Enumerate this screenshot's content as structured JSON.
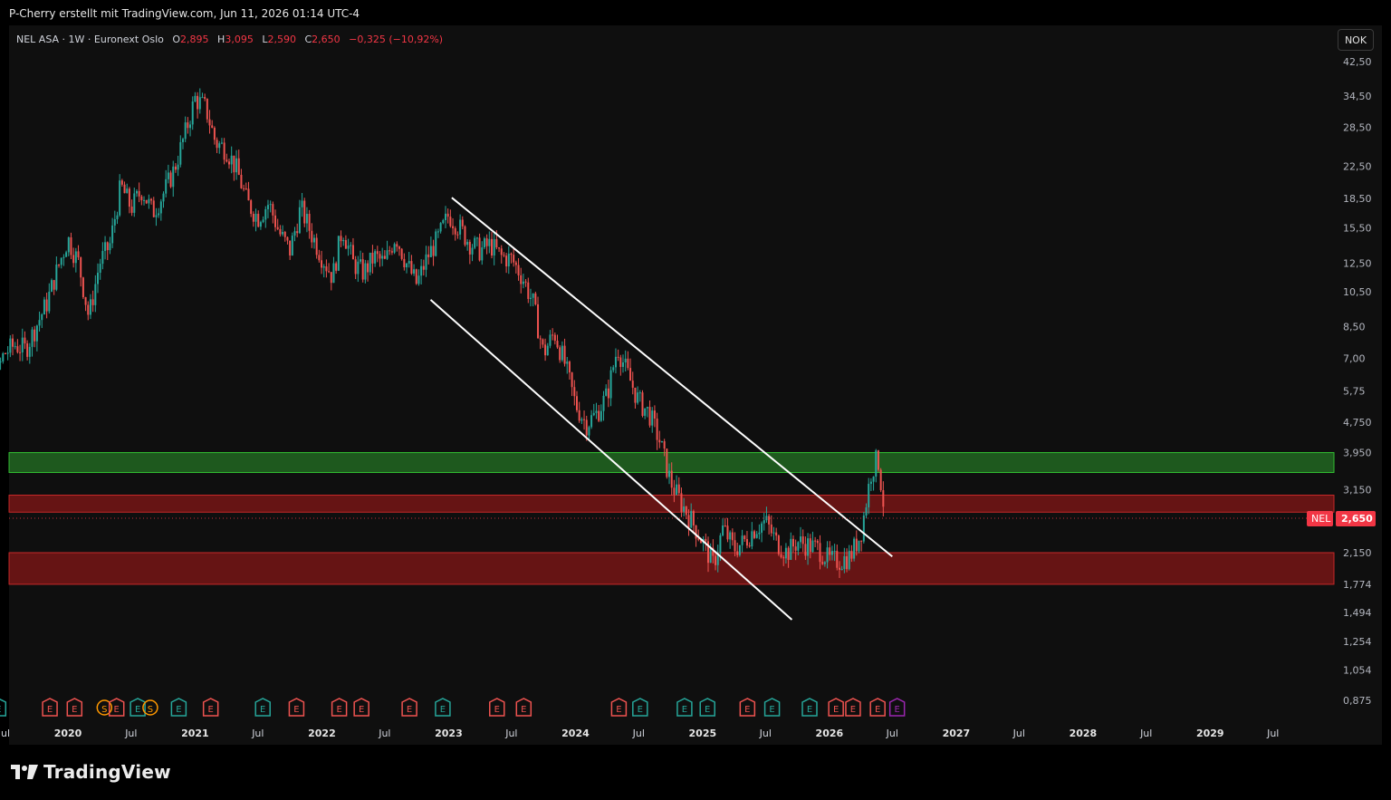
{
  "credit": "P-Cherry erstellt mit TradingView.com, Jun 11, 2026 01:14 UTC-4",
  "legend": {
    "symbol": "NEL ASA · 1W · Euronext Oslo",
    "o_label": "O",
    "o": "2,895",
    "h_label": "H",
    "h": "3,095",
    "l_label": "L",
    "l": "2,590",
    "c_label": "C",
    "c": "2,650",
    "change": "−0,325 (−10,92%)"
  },
  "currency": "NOK",
  "brand": "TradingView",
  "colors": {
    "up": "#26a69a",
    "down": "#ef5350",
    "support_zone": "#1f5d1f",
    "resistance_zone": "#6b1515",
    "channel": "#ffffff",
    "price_tag": "#f23645"
  },
  "chart_data": {
    "type": "candlestick",
    "symbol": "NEL",
    "timeframe": "1W",
    "y_scale": "log",
    "y_ticks": [
      "42,50",
      "34,50",
      "28,50",
      "22,50",
      "18,50",
      "15,50",
      "12,50",
      "10,50",
      "8,50",
      "7,00",
      "5,75",
      "4,750",
      "3,950",
      "3,150",
      "2,150",
      "1,774",
      "1,494",
      "1,254",
      "1,054",
      "0,875"
    ],
    "y_tick_values": [
      42.5,
      34.5,
      28.5,
      22.5,
      18.5,
      15.5,
      12.5,
      10.5,
      8.5,
      7.0,
      5.75,
      4.75,
      3.95,
      3.15,
      2.15,
      1.774,
      1.494,
      1.254,
      1.054,
      0.875
    ],
    "x_ticks": [
      {
        "label": "Jul",
        "date": "2019-07-01",
        "year": false
      },
      {
        "label": "2020",
        "date": "2020-01-01",
        "year": true
      },
      {
        "label": "Jul",
        "date": "2020-07-01",
        "year": false
      },
      {
        "label": "2021",
        "date": "2021-01-01",
        "year": true
      },
      {
        "label": "Jul",
        "date": "2021-07-01",
        "year": false
      },
      {
        "label": "2022",
        "date": "2022-01-01",
        "year": true
      },
      {
        "label": "Jul",
        "date": "2022-07-01",
        "year": false
      },
      {
        "label": "2023",
        "date": "2023-01-01",
        "year": true
      },
      {
        "label": "Jul",
        "date": "2023-07-01",
        "year": false
      },
      {
        "label": "2024",
        "date": "2024-01-01",
        "year": true
      },
      {
        "label": "Jul",
        "date": "2024-07-01",
        "year": false
      },
      {
        "label": "2025",
        "date": "2025-01-01",
        "year": true
      },
      {
        "label": "Jul",
        "date": "2025-07-01",
        "year": false
      },
      {
        "label": "2026",
        "date": "2026-01-01",
        "year": true
      },
      {
        "label": "Jul",
        "date": "2026-07-01",
        "year": false
      },
      {
        "label": "2027",
        "date": "2027-01-01",
        "year": true
      },
      {
        "label": "Jul",
        "date": "2027-07-01",
        "year": false
      },
      {
        "label": "2028",
        "date": "2028-01-01",
        "year": true
      },
      {
        "label": "Jul",
        "date": "2028-07-01",
        "year": false
      },
      {
        "label": "2029",
        "date": "2029-01-01",
        "year": true
      },
      {
        "label": "Jul",
        "date": "2029-07-01",
        "year": false
      }
    ],
    "price_path": [
      [
        "2019-03-01",
        5.8
      ],
      [
        "2019-04-01",
        8.0
      ],
      [
        "2019-05-01",
        6.8
      ],
      [
        "2019-06-01",
        6.0
      ],
      [
        "2019-07-01",
        7.2
      ],
      [
        "2019-08-01",
        7.6
      ],
      [
        "2019-09-01",
        7.4
      ],
      [
        "2019-10-01",
        8.5
      ],
      [
        "2019-11-01",
        9.8
      ],
      [
        "2019-12-01",
        12.0
      ],
      [
        "2020-01-01",
        14.5
      ],
      [
        "2020-02-01",
        12.5
      ],
      [
        "2020-03-01",
        9.0
      ],
      [
        "2020-04-01",
        12.5
      ],
      [
        "2020-05-01",
        14.0
      ],
      [
        "2020-06-01",
        20.0
      ],
      [
        "2020-07-01",
        17.5
      ],
      [
        "2020-08-01",
        19.5
      ],
      [
        "2020-09-01",
        17.0
      ],
      [
        "2020-10-01",
        19.0
      ],
      [
        "2020-11-01",
        22.0
      ],
      [
        "2020-12-01",
        27.0
      ],
      [
        "2021-01-01",
        34.0
      ],
      [
        "2021-02-01",
        32.0
      ],
      [
        "2021-03-01",
        26.0
      ],
      [
        "2021-04-01",
        25.0
      ],
      [
        "2021-05-01",
        22.0
      ],
      [
        "2021-06-01",
        18.0
      ],
      [
        "2021-07-01",
        16.5
      ],
      [
        "2021-08-01",
        18.0
      ],
      [
        "2021-09-01",
        15.0
      ],
      [
        "2021-10-01",
        13.5
      ],
      [
        "2021-11-01",
        17.5
      ],
      [
        "2021-12-01",
        15.0
      ],
      [
        "2022-01-01",
        13.0
      ],
      [
        "2022-02-01",
        11.5
      ],
      [
        "2022-03-01",
        15.5
      ],
      [
        "2022-04-01",
        12.5
      ],
      [
        "2022-05-01",
        11.8
      ],
      [
        "2022-06-01",
        13.0
      ],
      [
        "2022-07-01",
        12.5
      ],
      [
        "2022-08-01",
        14.8
      ],
      [
        "2022-09-01",
        12.5
      ],
      [
        "2022-10-01",
        11.0
      ],
      [
        "2022-11-01",
        13.0
      ],
      [
        "2022-12-01",
        14.5
      ],
      [
        "2023-01-01",
        16.8
      ],
      [
        "2023-02-01",
        15.5
      ],
      [
        "2023-03-01",
        14.2
      ],
      [
        "2023-04-01",
        13.5
      ],
      [
        "2023-05-01",
        14.0
      ],
      [
        "2023-06-01",
        13.0
      ],
      [
        "2023-07-01",
        12.8
      ],
      [
        "2023-08-01",
        11.5
      ],
      [
        "2023-09-01",
        9.8
      ],
      [
        "2023-10-01",
        7.2
      ],
      [
        "2023-11-01",
        8.2
      ],
      [
        "2023-12-01",
        6.8
      ],
      [
        "2024-01-01",
        5.3
      ],
      [
        "2024-02-01",
        4.7
      ],
      [
        "2024-03-01",
        5.0
      ],
      [
        "2024-04-01",
        5.6
      ],
      [
        "2024-05-01",
        7.5
      ],
      [
        "2024-06-01",
        6.3
      ],
      [
        "2024-07-01",
        5.4
      ],
      [
        "2024-08-01",
        5.0
      ],
      [
        "2024-09-01",
        4.2
      ],
      [
        "2024-10-01",
        3.3
      ],
      [
        "2024-11-01",
        2.9
      ],
      [
        "2024-12-01",
        2.6
      ],
      [
        "2025-01-01",
        2.3
      ],
      [
        "2025-02-01",
        2.0
      ],
      [
        "2025-03-01",
        2.5
      ],
      [
        "2025-04-01",
        2.2
      ],
      [
        "2025-05-01",
        2.3
      ],
      [
        "2025-06-01",
        2.5
      ],
      [
        "2025-07-01",
        2.6
      ],
      [
        "2025-08-01",
        2.3
      ],
      [
        "2025-09-01",
        2.15
      ],
      [
        "2025-10-01",
        2.3
      ],
      [
        "2025-11-01",
        2.25
      ],
      [
        "2025-12-01",
        2.2
      ],
      [
        "2026-01-01",
        2.05
      ],
      [
        "2026-02-01",
        2.05
      ],
      [
        "2026-03-01",
        2.1
      ],
      [
        "2026-04-01",
        2.4
      ],
      [
        "2026-05-01",
        3.5
      ],
      [
        "2026-05-20",
        3.85
      ],
      [
        "2026-06-11",
        2.65
      ]
    ],
    "last_price": "2,650",
    "last_price_label": "NEL",
    "zones": [
      {
        "kind": "support",
        "from": 3.95,
        "to": 3.5
      },
      {
        "kind": "resistance",
        "from": 3.05,
        "to": 2.75
      },
      {
        "kind": "resistance",
        "from": 2.15,
        "to": 1.774
      }
    ],
    "channel": [
      {
        "from": [
          "2023-01-10",
          18.6
        ],
        "to": [
          "2026-07-01",
          2.1
        ]
      },
      {
        "from": [
          "2022-11-10",
          10.0
        ],
        "to": [
          "2025-09-15",
          1.43
        ]
      }
    ],
    "event_markers": [
      {
        "date": "2019-06-15",
        "code": "E",
        "color": "#26a69a"
      },
      {
        "date": "2019-11-10",
        "code": "E",
        "color": "#ef5350"
      },
      {
        "date": "2020-01-20",
        "code": "E",
        "color": "#ef5350"
      },
      {
        "date": "2020-04-15",
        "code": "S",
        "color": "#ff9800"
      },
      {
        "date": "2020-05-20",
        "code": "E",
        "color": "#ef5350"
      },
      {
        "date": "2020-07-20",
        "code": "E",
        "color": "#26a69a"
      },
      {
        "date": "2020-08-25",
        "code": "S",
        "color": "#ff9800"
      },
      {
        "date": "2020-11-15",
        "code": "E",
        "color": "#26a69a"
      },
      {
        "date": "2021-02-15",
        "code": "E",
        "color": "#ef5350"
      },
      {
        "date": "2021-07-15",
        "code": "E",
        "color": "#26a69a"
      },
      {
        "date": "2021-10-20",
        "code": "E",
        "color": "#ef5350"
      },
      {
        "date": "2022-02-20",
        "code": "E",
        "color": "#ef5350"
      },
      {
        "date": "2022-04-25",
        "code": "E",
        "color": "#ef5350"
      },
      {
        "date": "2022-09-10",
        "code": "E",
        "color": "#ef5350"
      },
      {
        "date": "2022-12-15",
        "code": "E",
        "color": "#26a69a"
      },
      {
        "date": "2023-05-20",
        "code": "E",
        "color": "#ef5350"
      },
      {
        "date": "2023-08-05",
        "code": "E",
        "color": "#ef5350"
      },
      {
        "date": "2024-05-05",
        "code": "E",
        "color": "#ef5350"
      },
      {
        "date": "2024-07-05",
        "code": "E",
        "color": "#26a69a"
      },
      {
        "date": "2024-11-10",
        "code": "E",
        "color": "#26a69a"
      },
      {
        "date": "2025-01-15",
        "code": "E",
        "color": "#26a69a"
      },
      {
        "date": "2025-05-10",
        "code": "E",
        "color": "#ef5350"
      },
      {
        "date": "2025-07-20",
        "code": "E",
        "color": "#26a69a"
      },
      {
        "date": "2025-11-05",
        "code": "E",
        "color": "#26a69a"
      },
      {
        "date": "2026-01-20",
        "code": "E",
        "color": "#ef5350"
      },
      {
        "date": "2026-03-10",
        "code": "E",
        "color": "#ef5350"
      },
      {
        "date": "2026-05-20",
        "code": "E",
        "color": "#ef5350"
      },
      {
        "date": "2026-07-15",
        "code": "E",
        "color": "#9c27b0"
      }
    ]
  }
}
